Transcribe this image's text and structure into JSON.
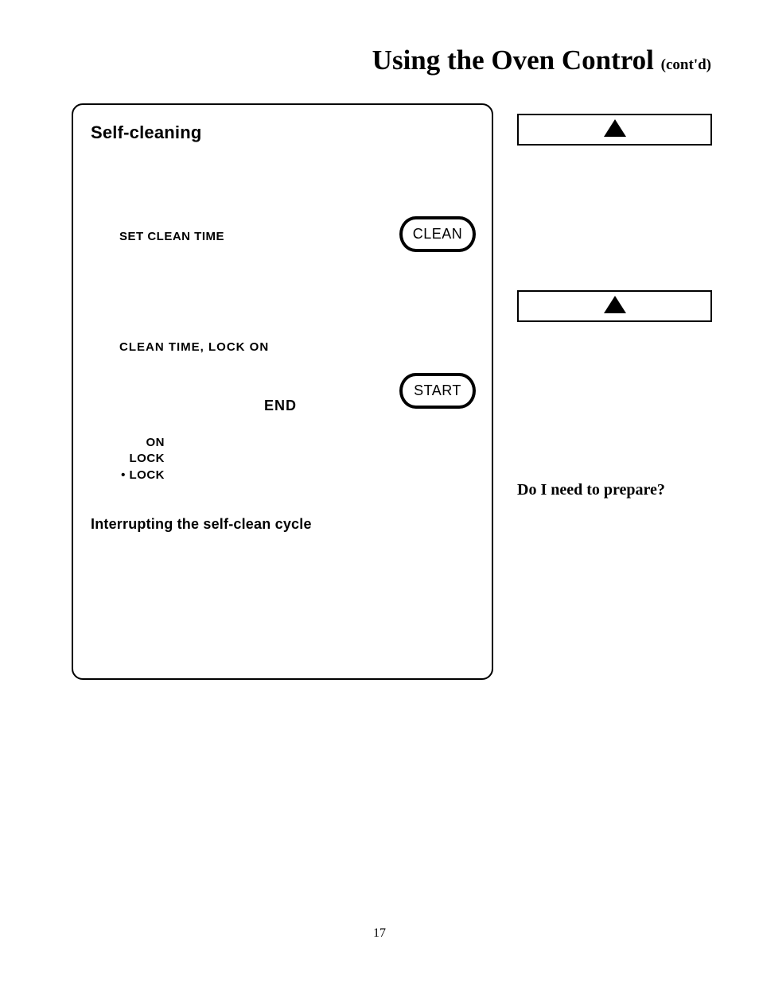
{
  "header": {
    "title_main": "Using the Oven Control ",
    "title_contd": "(cont'd)"
  },
  "panel": {
    "heading": "Self-cleaning",
    "set_clean_time_label": "SET CLEAN TIME",
    "clean_button_label": "CLEAN",
    "clean_time_lock_label": "CLEAN  TIME, LOCK  ON",
    "end_label": "END",
    "start_button_label": "START",
    "stack": {
      "line1": "ON",
      "line2": "LOCK",
      "line3": "• LOCK"
    },
    "subheading": "Interrupting the self-clean cycle"
  },
  "sidebar": {
    "box1_icon": "up-triangle-icon",
    "box2_icon": "up-triangle-icon",
    "question": "Do I need to prepare?"
  },
  "footer": {
    "page_number": "17"
  }
}
